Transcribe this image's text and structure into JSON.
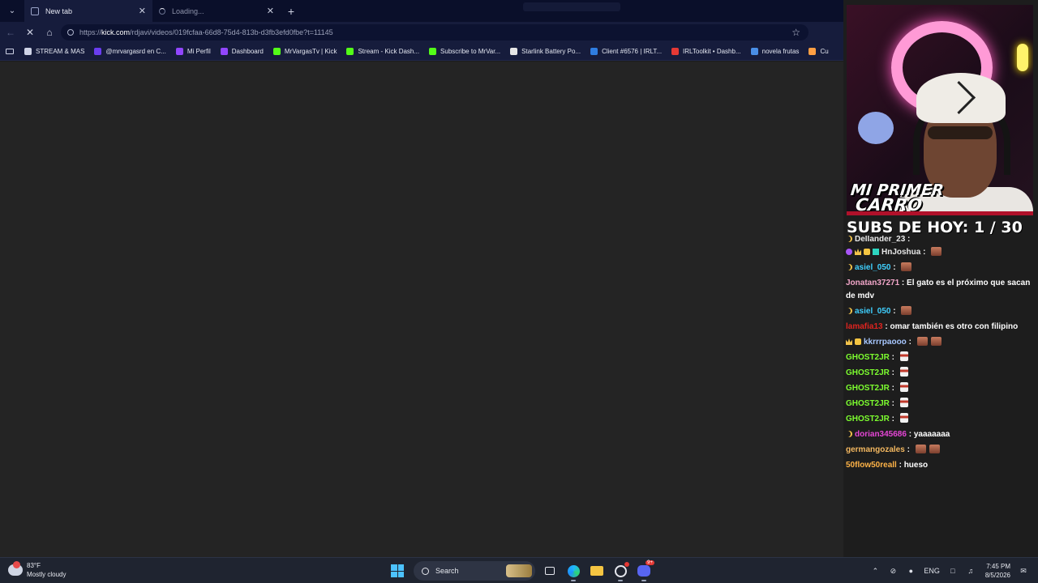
{
  "browser": {
    "tabs": [
      {
        "title": "New tab",
        "state": "active"
      },
      {
        "title": "Loading...",
        "state": "loading"
      }
    ],
    "new_tab_symbol": "+",
    "url_scheme": "https://",
    "url_host": "kick.com",
    "url_path": "/rdjavi/videos/019fcfaa-66d8-75d4-813b-d3fb3efd0fbe?t=11145",
    "bookmarks": [
      {
        "label": "STREAM & MAS",
        "icon": "folder-icon",
        "color": "#cfd3e6"
      },
      {
        "label": "@mrvargasrd en C...",
        "icon": "purple-site-icon",
        "color": "#6a3df0"
      },
      {
        "label": "Mi Perfil",
        "icon": "twitch-icon",
        "color": "#9146ff"
      },
      {
        "label": "Dashboard",
        "icon": "twitch-icon",
        "color": "#9146ff"
      },
      {
        "label": "MrVargasTv | Kick",
        "icon": "kick-icon",
        "color": "#53fc18"
      },
      {
        "label": "Stream - Kick Dash...",
        "icon": "kick-icon",
        "color": "#53fc18"
      },
      {
        "label": "Subscribe to MrVar...",
        "icon": "kick-icon",
        "color": "#53fc18"
      },
      {
        "label": "Starlink Battery Po...",
        "icon": "page-icon",
        "color": "#e6e6e6"
      },
      {
        "label": "Client #6576 | IRLT...",
        "icon": "cloud-icon",
        "color": "#2f7de1"
      },
      {
        "label": "IRLToolkit • Dashb...",
        "icon": "irltoolkit-icon",
        "color": "#e53935"
      },
      {
        "label": "novela frutas",
        "icon": "photo-icon",
        "color": "#4a8fe7"
      },
      {
        "label": "Cu",
        "icon": "bookmark-icon",
        "color": "#ff9f43"
      }
    ]
  },
  "overlay": {
    "cam_title_line1": "MI PRIMER",
    "cam_title_line2": "CARRO",
    "subs_label": "SUBS DE HOY: 1 / 30",
    "chat": [
      {
        "user": "Dellander_23",
        "color": "#e8e8e8",
        "text": "",
        "emotes": 0,
        "badges": [
          "moon"
        ],
        "partial": true
      },
      {
        "user": "HnJoshua",
        "color": "#e8e8e8",
        "text": "",
        "emotes": 1,
        "badges": [
          "purple",
          "crown",
          "sub",
          "gift"
        ]
      },
      {
        "user": "asiel_050",
        "color": "#3fd0ff",
        "text": "",
        "emotes": 1,
        "badges": [
          "moon"
        ]
      },
      {
        "user": "Jonatan37271",
        "color": "#f2a6c9",
        "text": "El gato es el próximo que sacan de mdv",
        "emotes": 0,
        "badges": []
      },
      {
        "user": "asiel_050",
        "color": "#3fd0ff",
        "text": "",
        "emotes": 1,
        "badges": [
          "moon"
        ]
      },
      {
        "user": "lamafia13",
        "color": "#e0241f",
        "text": "omar también es otro con filipino",
        "emotes": 0,
        "badges": []
      },
      {
        "user": "kkrrrpaooo",
        "color": "#a7c7ff",
        "text": "",
        "emotes": 2,
        "badges": [
          "crown",
          "sub"
        ]
      },
      {
        "user": "GHOST2JR",
        "color": "#7dff2f",
        "text": "",
        "emotes": 1,
        "badges": [],
        "emote_type": "cup"
      },
      {
        "user": "GHOST2JR",
        "color": "#7dff2f",
        "text": "",
        "emotes": 1,
        "badges": [],
        "emote_type": "cup"
      },
      {
        "user": "GHOST2JR",
        "color": "#7dff2f",
        "text": "",
        "emotes": 1,
        "badges": [],
        "emote_type": "cup"
      },
      {
        "user": "GHOST2JR",
        "color": "#7dff2f",
        "text": "",
        "emotes": 1,
        "badges": [],
        "emote_type": "cup"
      },
      {
        "user": "GHOST2JR",
        "color": "#7dff2f",
        "text": "",
        "emotes": 1,
        "badges": [],
        "emote_type": "cup"
      },
      {
        "user": "dorian345686",
        "color": "#e646d6",
        "text": "yaaaaaaa",
        "emotes": 0,
        "badges": [
          "moon"
        ]
      },
      {
        "user": "germangozales",
        "color": "#f4b860",
        "text": "",
        "emotes": 2,
        "badges": []
      },
      {
        "user": "50flow50reall",
        "color": "#ffb347",
        "text": "hueso",
        "emotes": 0,
        "badges": []
      }
    ]
  },
  "taskbar": {
    "weather_temp": "83°F",
    "weather_desc": "Mostly cloudy",
    "search_label": "Search",
    "lang": "ENG",
    "time": "7:45 PM",
    "date": "8/5/2026",
    "discord_badge": "9+"
  },
  "colors": {
    "tabbar": "#0a0f2a",
    "toolbar": "#161c3c",
    "content": "#242424",
    "taskbar": "#1f2430"
  }
}
